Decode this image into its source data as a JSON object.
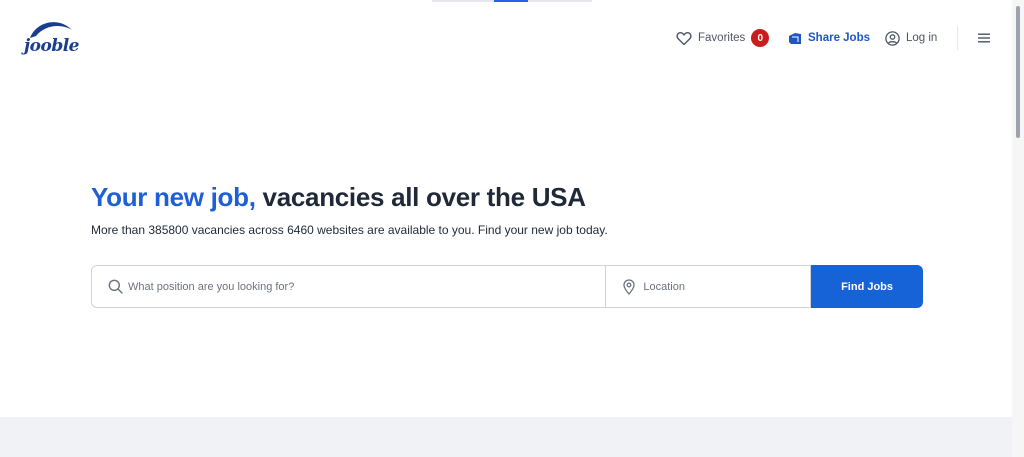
{
  "brand": {
    "logo_text": "jooble",
    "logo_colors": {
      "text": "#1b3d8f",
      "swoosh": "#1b3d8f",
      "accent": "#7dbb3f"
    }
  },
  "nav": {
    "favorites_label": "Favorites",
    "favorites_count": "0",
    "share_jobs_label": "Share Jobs",
    "login_label": "Log in"
  },
  "hero": {
    "title_accent": "Your new job,",
    "title_rest": " vacancies all over the USA",
    "subtitle": "More than 385800 vacancies across 6460 websites are available to you. Find your new job today."
  },
  "search": {
    "position_placeholder": "What position are you looking for?",
    "position_value": "",
    "location_placeholder": "Location",
    "location_value": "",
    "button_label": "Find Jobs"
  },
  "colors": {
    "accent": "#1e5fd4",
    "button": "#1563d6",
    "badge": "#c81e1e",
    "band": "#f0f2f6"
  },
  "icons": [
    "heart-icon",
    "share-icon",
    "user-icon",
    "hamburger-icon",
    "search-icon",
    "location-pin-icon"
  ]
}
